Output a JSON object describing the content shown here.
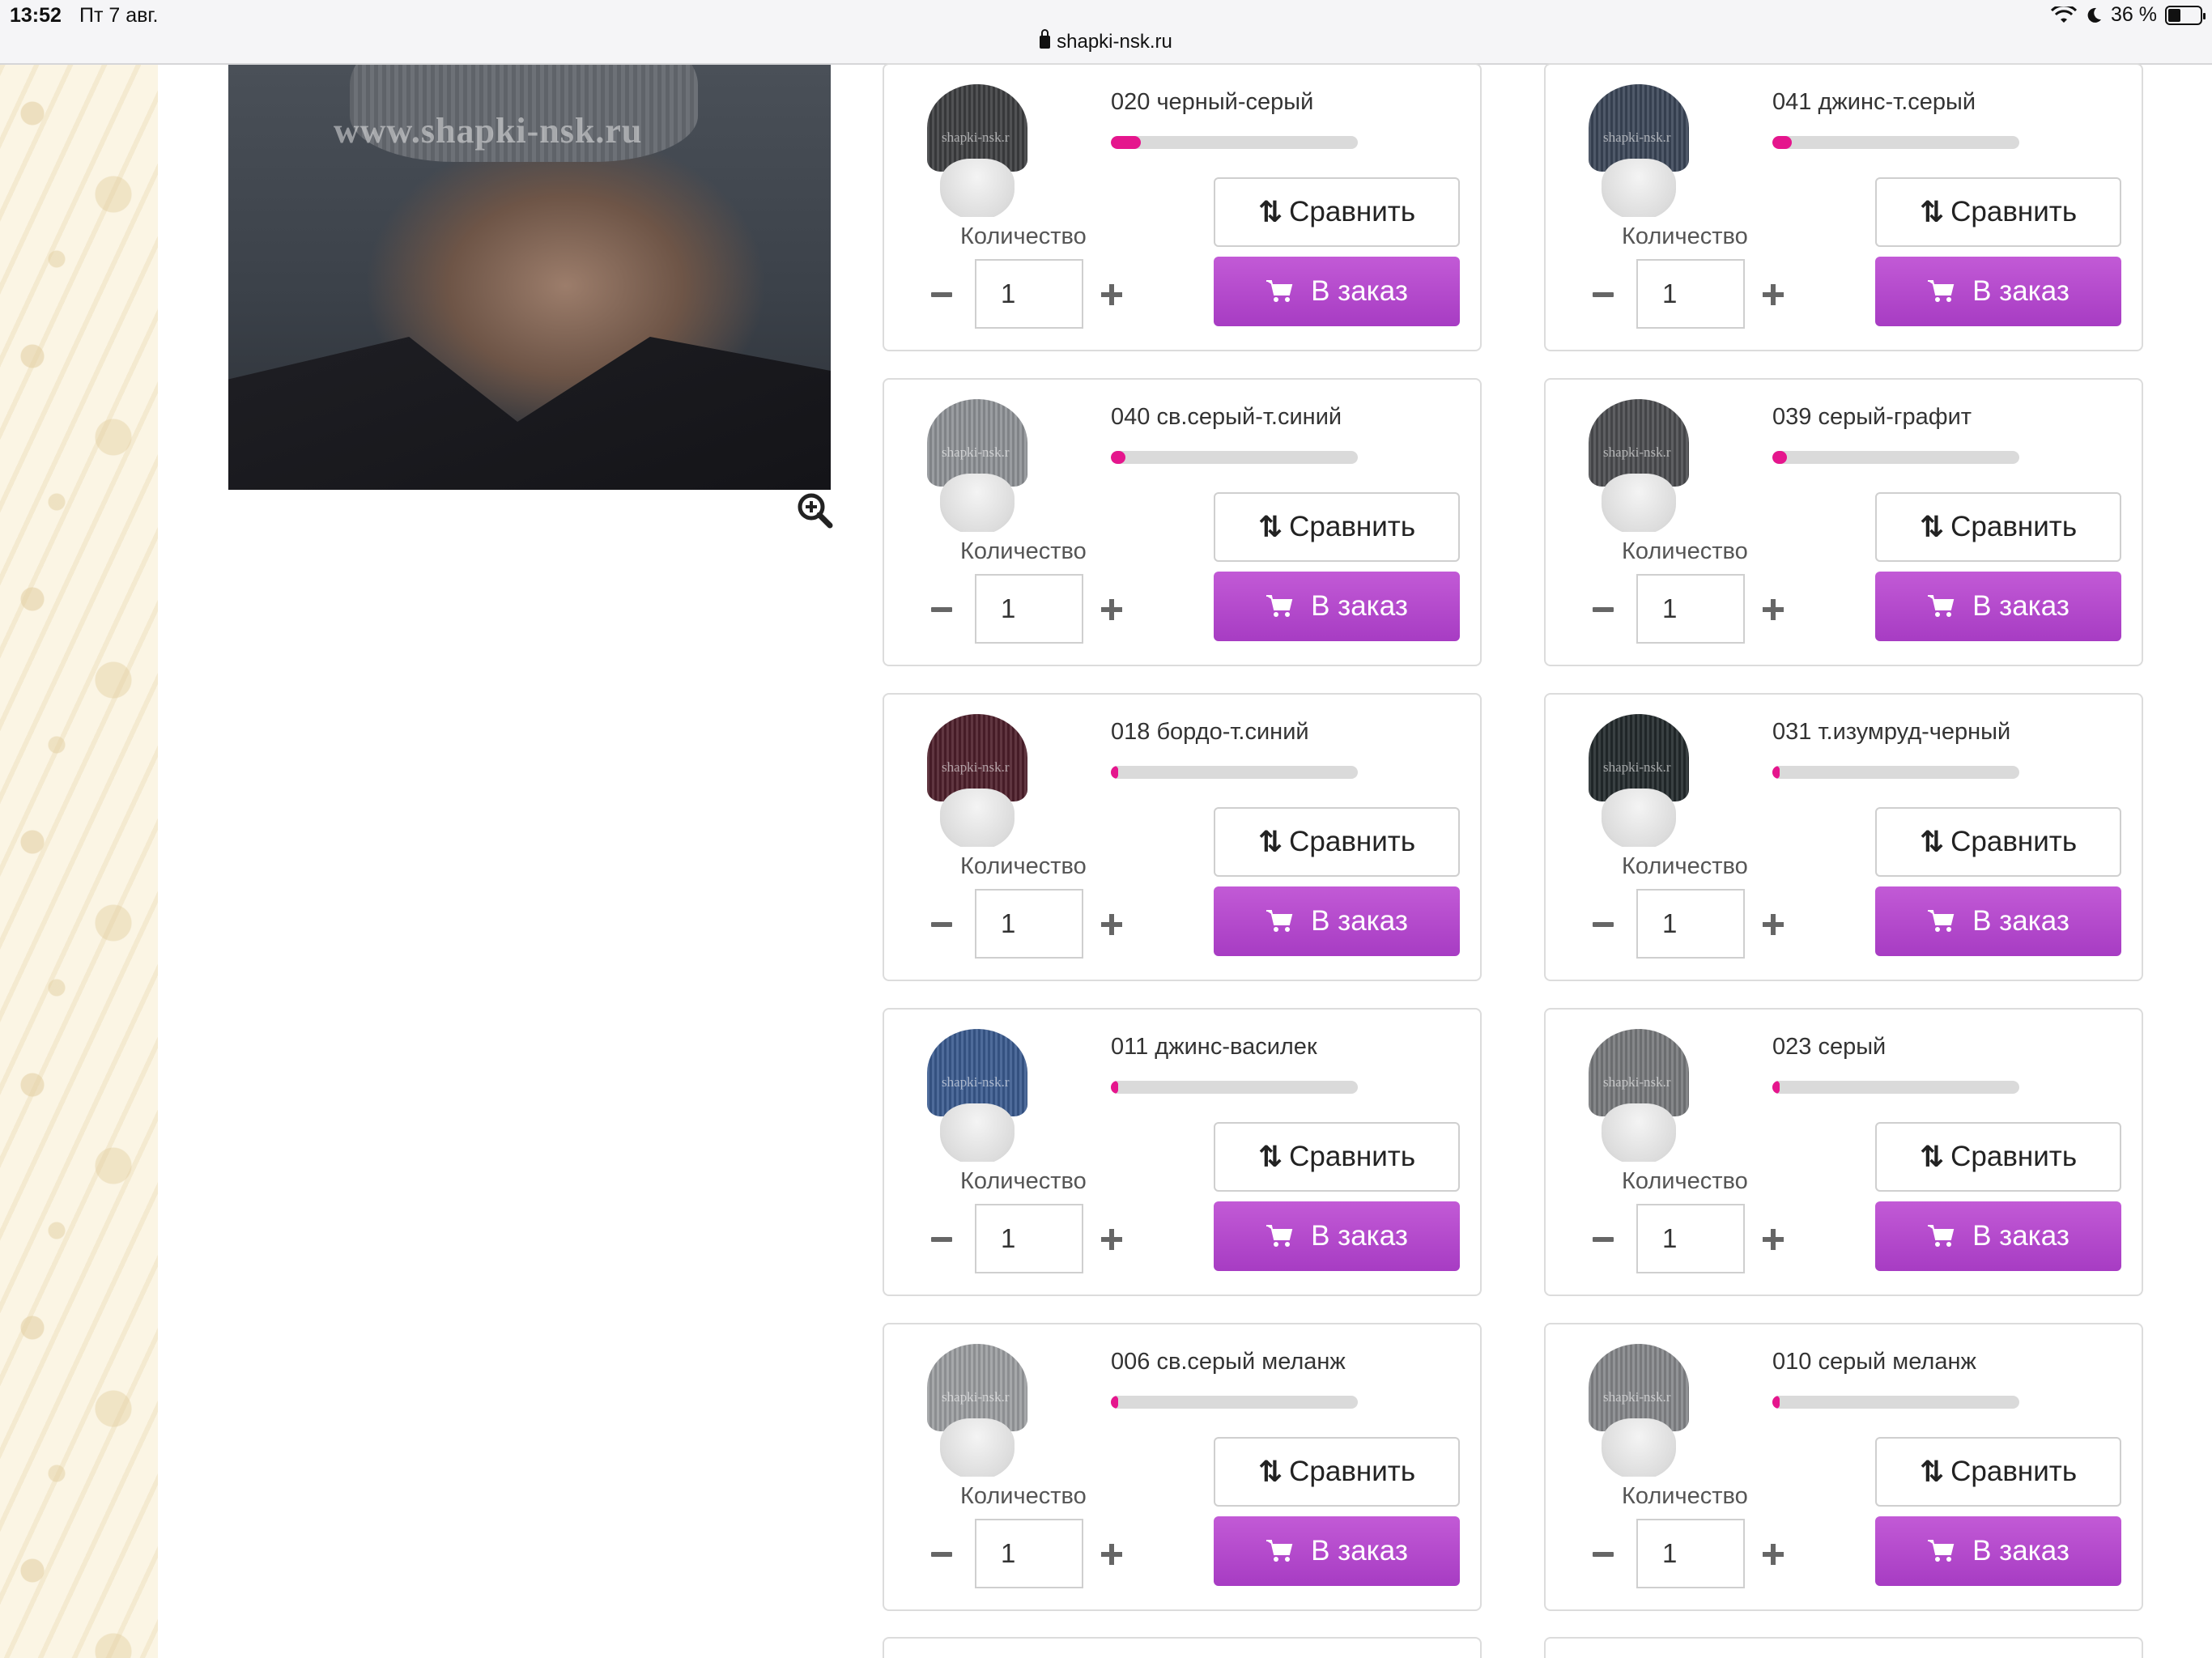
{
  "status_bar": {
    "time": "13:52",
    "date": "Пт 7 авг.",
    "battery": "36 %"
  },
  "browser": {
    "url": "shapki-nsk.ru"
  },
  "hero": {
    "watermark": "www.shapki-nsk.ru"
  },
  "labels": {
    "quantity": "Количество",
    "compare": "Сравнить",
    "order": "В заказ",
    "thumb_watermark": "shapki-nsk.r"
  },
  "colors": {
    "accent": "#b046c9",
    "stock_fill": "#e5168d",
    "stock_track": "#dadada"
  },
  "products": [
    {
      "name": "020 черный-серый",
      "qty": "1",
      "stock": 0.12,
      "color": "#3d3e41"
    },
    {
      "name": "041 джинс-т.серый",
      "qty": "1",
      "stock": 0.08,
      "color": "#3b4658"
    },
    {
      "name": "040 св.серый-т.синий",
      "qty": "1",
      "stock": 0.06,
      "color": "#8f9296"
    },
    {
      "name": "039 серый-графит",
      "qty": "1",
      "stock": 0.06,
      "color": "#4c4d50"
    },
    {
      "name": "018 бордо-т.синий",
      "qty": "1",
      "stock": 0.03,
      "color": "#4e1f2b"
    },
    {
      "name": "031 т.изумруд-черный",
      "qty": "1",
      "stock": 0.03,
      "color": "#232a2c"
    },
    {
      "name": "011 джинс-василек",
      "qty": "1",
      "stock": 0.02,
      "color": "#3a5a8f"
    },
    {
      "name": "023 серый",
      "qty": "1",
      "stock": 0.02,
      "color": "#77797c"
    },
    {
      "name": "006 св.серый меланж",
      "qty": "1",
      "stock": 0.02,
      "color": "#9c9ea1"
    },
    {
      "name": "010 серый меланж",
      "qty": "1",
      "stock": 0.01,
      "color": "#85878a"
    }
  ]
}
